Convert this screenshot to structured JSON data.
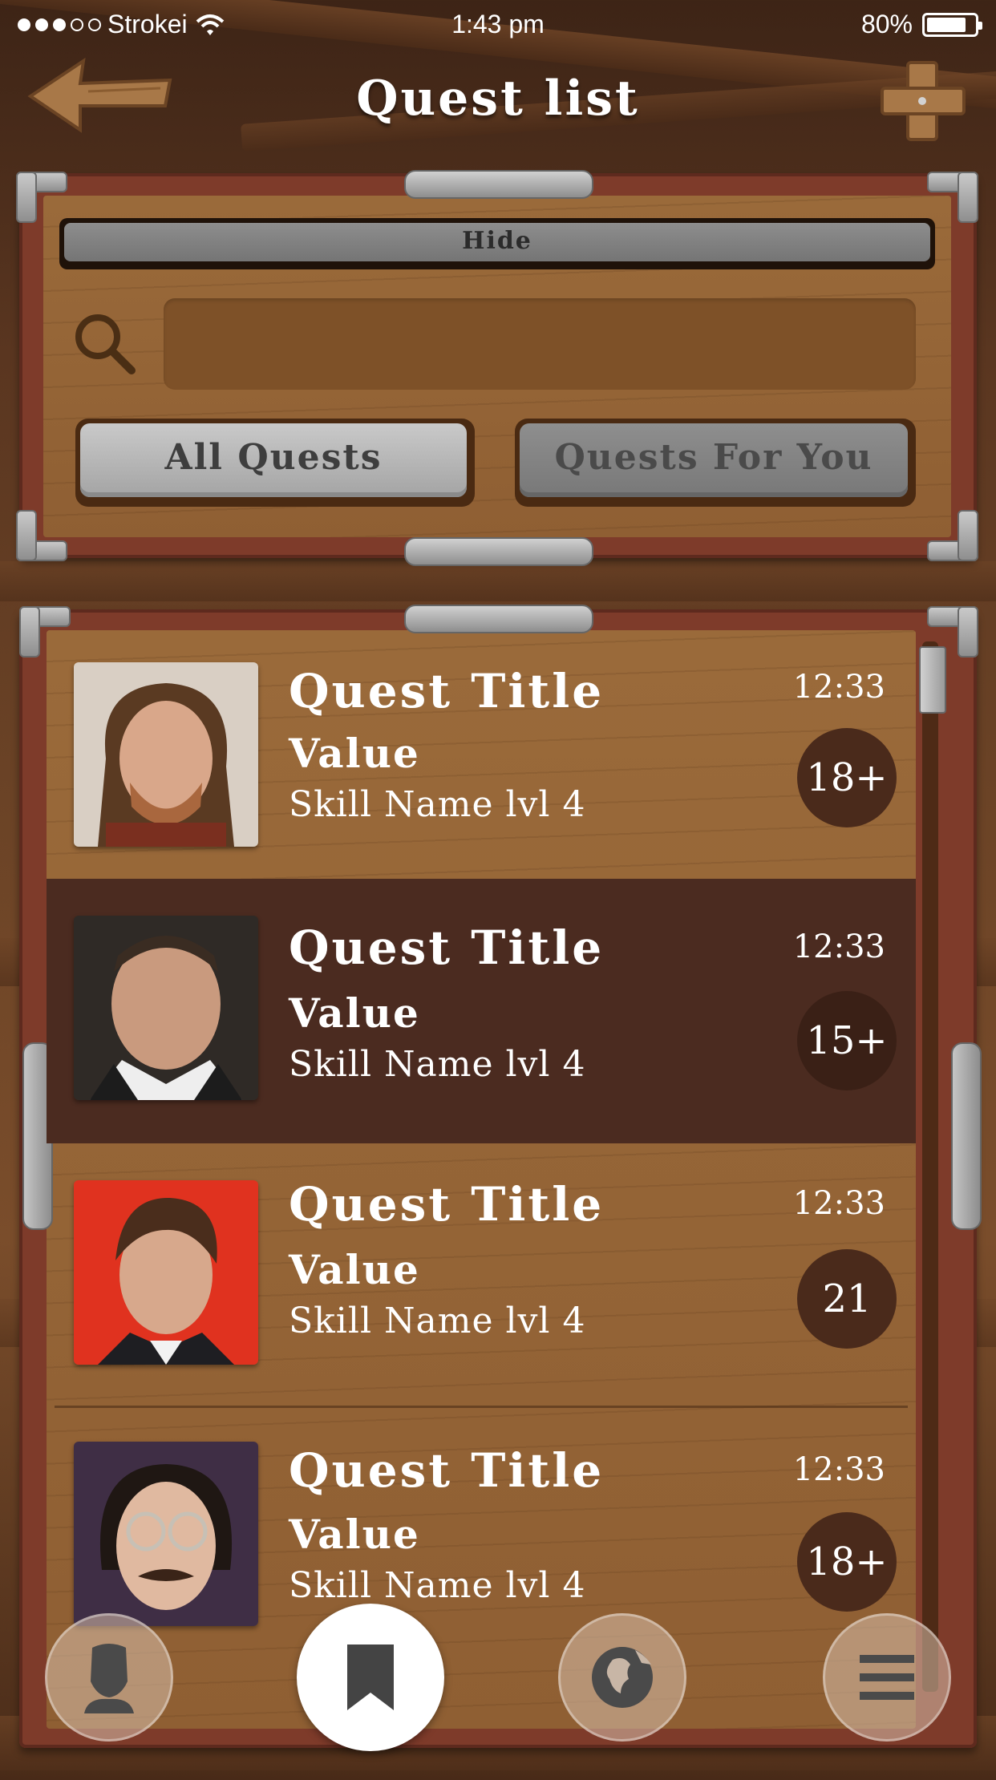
{
  "status_bar": {
    "carrier": "Strokei",
    "time": "1:43 pm",
    "battery": "80%",
    "signal_dots_filled": 3,
    "signal_dots_total": 5
  },
  "header": {
    "title": "Quest list",
    "back_icon": "wooden-arrow-left-icon",
    "add_icon": "wooden-plus-icon"
  },
  "filter_panel": {
    "hide_label": "Hide",
    "search": {
      "value": "",
      "placeholder": ""
    },
    "segments": [
      {
        "label": "All Quests",
        "selected": true
      },
      {
        "label": "Quests For You",
        "selected": false
      }
    ]
  },
  "quests": [
    {
      "title": "Quest Title",
      "value": "Value",
      "skill": "Skill Name lvl 4",
      "time": "12:33",
      "age": "18+",
      "selected": false,
      "photo_bg": "#d9cfc4"
    },
    {
      "title": "Quest Title",
      "value": "Value",
      "skill": "Skill Name lvl 4",
      "time": "12:33",
      "age": "15+",
      "selected": true,
      "photo_bg": "#2f2a26"
    },
    {
      "title": "Quest Title",
      "value": "Value",
      "skill": "Skill Name lvl 4",
      "time": "12:33",
      "age": "21",
      "selected": false,
      "photo_bg": "#e0321f"
    },
    {
      "title": "Quest Title",
      "value": "Value",
      "skill": "Skill Name lvl 4",
      "time": "12:33",
      "age": "18+",
      "selected": false,
      "photo_bg": "#3f2e45"
    }
  ],
  "tab_bar": [
    {
      "icon": "profile-silhouette-icon",
      "active": false
    },
    {
      "icon": "bookmark-icon",
      "active": true
    },
    {
      "icon": "globe-icon",
      "active": false
    },
    {
      "icon": "menu-icon",
      "active": false
    }
  ],
  "colors": {
    "wood": "#9a6a3a",
    "frame_red": "#7e3b2a",
    "selected_row": "#4b2b20",
    "badge": "#4a2a1b",
    "metal": "#a4a4a4"
  }
}
